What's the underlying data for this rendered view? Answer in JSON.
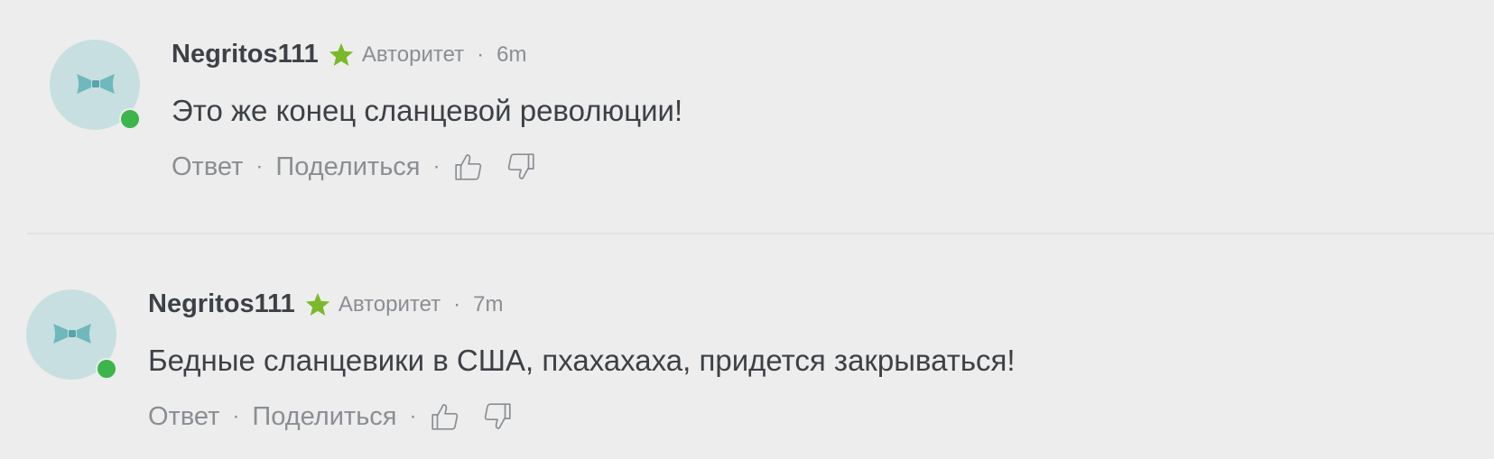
{
  "comments": [
    {
      "username": "Negritos111",
      "badge": "Авторитет",
      "separator": "·",
      "time": "6m",
      "text": "Это же конец сланцевой революции!",
      "reply_label": "Ответ",
      "share_label": "Поделиться",
      "online": true
    },
    {
      "username": "Negritos111",
      "badge": "Авторитет",
      "separator": "·",
      "time": "7m",
      "text": "Бедные сланцевики в США, пхахахаха, придется закрываться!",
      "reply_label": "Ответ",
      "share_label": "Поделиться",
      "online": true
    }
  ],
  "icons": {
    "avatar": "bow-tie-icon",
    "badge": "star-icon",
    "upvote": "thumbs-up-icon",
    "downvote": "thumbs-down-icon"
  },
  "colors": {
    "background": "#ededed",
    "avatar": "#c7dfe0",
    "bow_tie": "#6fb8bd",
    "online": "#3cb54a",
    "star": "#7ab929",
    "text": "#3d4146",
    "muted": "#8a8e93"
  }
}
